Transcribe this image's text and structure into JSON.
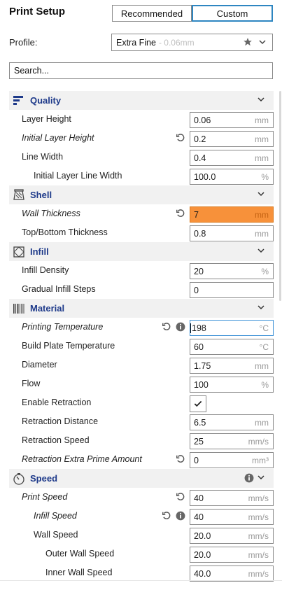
{
  "header": {
    "title": "Print Setup",
    "modes": [
      "Recommended",
      "Custom"
    ],
    "active_mode": "Custom"
  },
  "profile": {
    "label": "Profile:",
    "name": "Extra Fine",
    "sub": " - 0.06mm",
    "icons": [
      "star-icon",
      "chevron-down-icon"
    ]
  },
  "search": {
    "placeholder": "Search..."
  },
  "sections": [
    {
      "name": "Quality",
      "icon": "quality-icon",
      "settings": [
        {
          "label": "Layer Height",
          "value": "0.06",
          "unit": "mm",
          "indent": 0
        },
        {
          "label": "Initial Layer Height",
          "value": "0.2",
          "unit": "mm",
          "indent": 0,
          "italic": true,
          "reset": true
        },
        {
          "label": "Line Width",
          "value": "0.4",
          "unit": "mm",
          "indent": 0
        },
        {
          "label": "Initial Layer Line Width",
          "value": "100.0",
          "unit": "%",
          "indent": 1
        }
      ]
    },
    {
      "name": "Shell",
      "icon": "shell-icon",
      "settings": [
        {
          "label": "Wall Thickness",
          "value": "7",
          "unit": "mm",
          "indent": 0,
          "italic": true,
          "reset": true,
          "warning": true
        },
        {
          "label": "Top/Bottom Thickness",
          "value": "0.8",
          "unit": "mm",
          "indent": 0
        }
      ]
    },
    {
      "name": "Infill",
      "icon": "infill-icon",
      "settings": [
        {
          "label": "Infill Density",
          "value": "20",
          "unit": "%",
          "indent": 0
        },
        {
          "label": "Gradual Infill Steps",
          "value": "0",
          "unit": "",
          "indent": 0
        }
      ]
    },
    {
      "name": "Material",
      "icon": "material-icon",
      "settings": [
        {
          "label": "Printing Temperature",
          "value": "198",
          "unit": "°C",
          "indent": 0,
          "italic": true,
          "reset": true,
          "info": true,
          "focused": true
        },
        {
          "label": "Build Plate Temperature",
          "value": "60",
          "unit": "°C",
          "indent": 0
        },
        {
          "label": "Diameter",
          "value": "1.75",
          "unit": "mm",
          "indent": 0
        },
        {
          "label": "Flow",
          "value": "100",
          "unit": "%",
          "indent": 0
        },
        {
          "label": "Enable Retraction",
          "type": "checkbox",
          "checked": true,
          "indent": 0
        },
        {
          "label": "Retraction Distance",
          "value": "6.5",
          "unit": "mm",
          "indent": 0
        },
        {
          "label": "Retraction Speed",
          "value": "25",
          "unit": "mm/s",
          "indent": 0
        },
        {
          "label": "Retraction Extra Prime Amount",
          "value": "0",
          "unit": "mm³",
          "indent": 0,
          "italic": true,
          "reset": true
        }
      ]
    },
    {
      "name": "Speed",
      "icon": "speed-icon",
      "header_info": true,
      "settings": [
        {
          "label": "Print Speed",
          "value": "40",
          "unit": "mm/s",
          "indent": 0,
          "italic": true,
          "reset": true
        },
        {
          "label": "Infill Speed",
          "value": "40",
          "unit": "mm/s",
          "indent": 1,
          "italic": true,
          "reset": true,
          "info": true
        },
        {
          "label": "Wall Speed",
          "value": "20.0",
          "unit": "mm/s",
          "indent": 1
        },
        {
          "label": "Outer Wall Speed",
          "value": "20.0",
          "unit": "mm/s",
          "indent": 2
        },
        {
          "label": "Inner Wall Speed",
          "value": "40.0",
          "unit": "mm/s",
          "indent": 2
        }
      ]
    }
  ]
}
